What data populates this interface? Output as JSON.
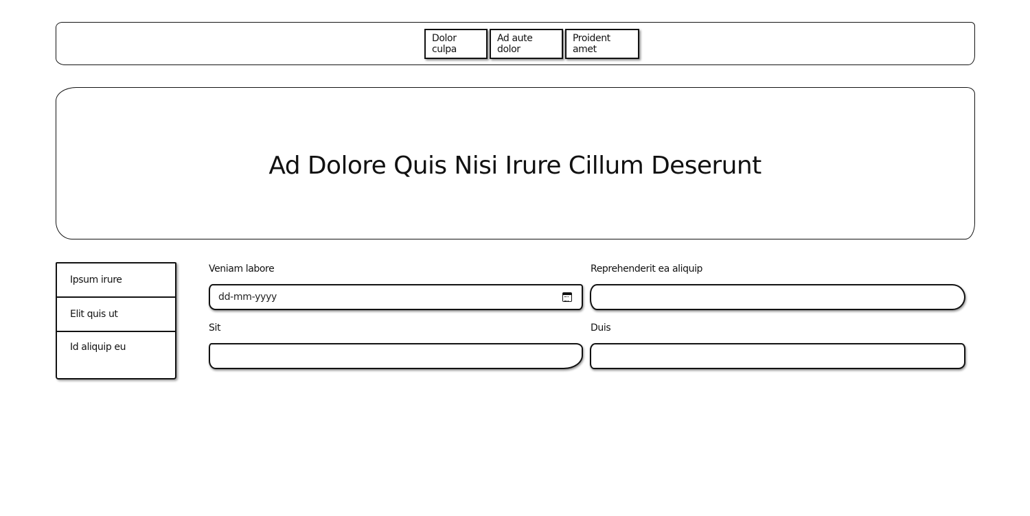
{
  "nav": {
    "items": [
      "Dolor culpa",
      "Ad aute dolor",
      "Proident amet"
    ]
  },
  "hero": {
    "title": "Ad Dolore Quis Nisi Irure Cillum Deserunt"
  },
  "sidebar": {
    "items": [
      "Ipsum irure",
      "Elit quis ut",
      "Id aliquip eu"
    ]
  },
  "form": {
    "veniam_label": "Veniam labore",
    "veniam_placeholder": "dd-mm-yyyy",
    "reprehenderit_label": "Reprehenderit ea aliquip",
    "reprehenderit_value": "",
    "sit_label": "Sit",
    "sit_value": "",
    "duis_label": "Duis",
    "duis_value": ""
  },
  "icons": {
    "date_picker": "calendar-icon"
  }
}
